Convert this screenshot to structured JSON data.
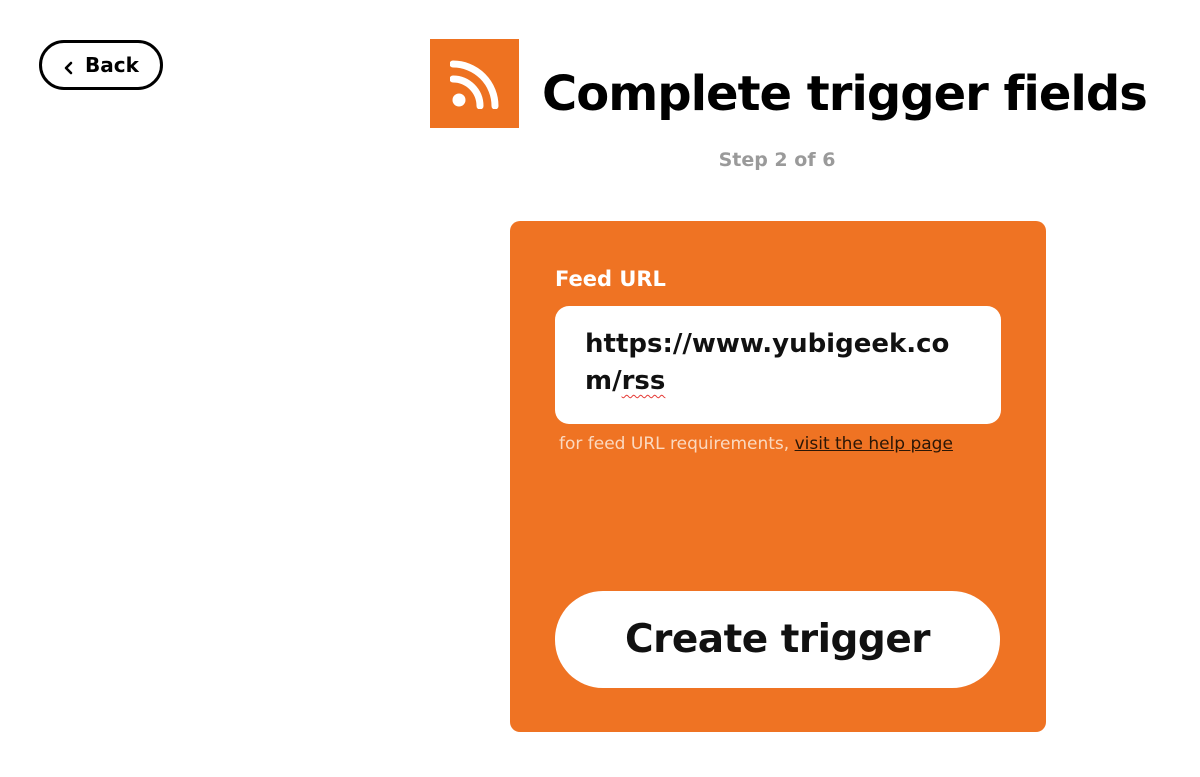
{
  "header": {
    "back_label": "Back",
    "title": "Complete trigger fields",
    "step": "Step 2 of 6",
    "service_icon": "rss-icon"
  },
  "form": {
    "field_label": "Feed URL",
    "url_value_part1": "https://www.yubigeek.com/",
    "url_value_part2": "rss",
    "help_prefix": "for feed URL requirements, ",
    "help_link": "visit the help page",
    "submit_label": "Create trigger"
  },
  "colors": {
    "brand_orange": "#ee7221",
    "background": "#ffffff",
    "step_text": "#9a9a9a"
  }
}
